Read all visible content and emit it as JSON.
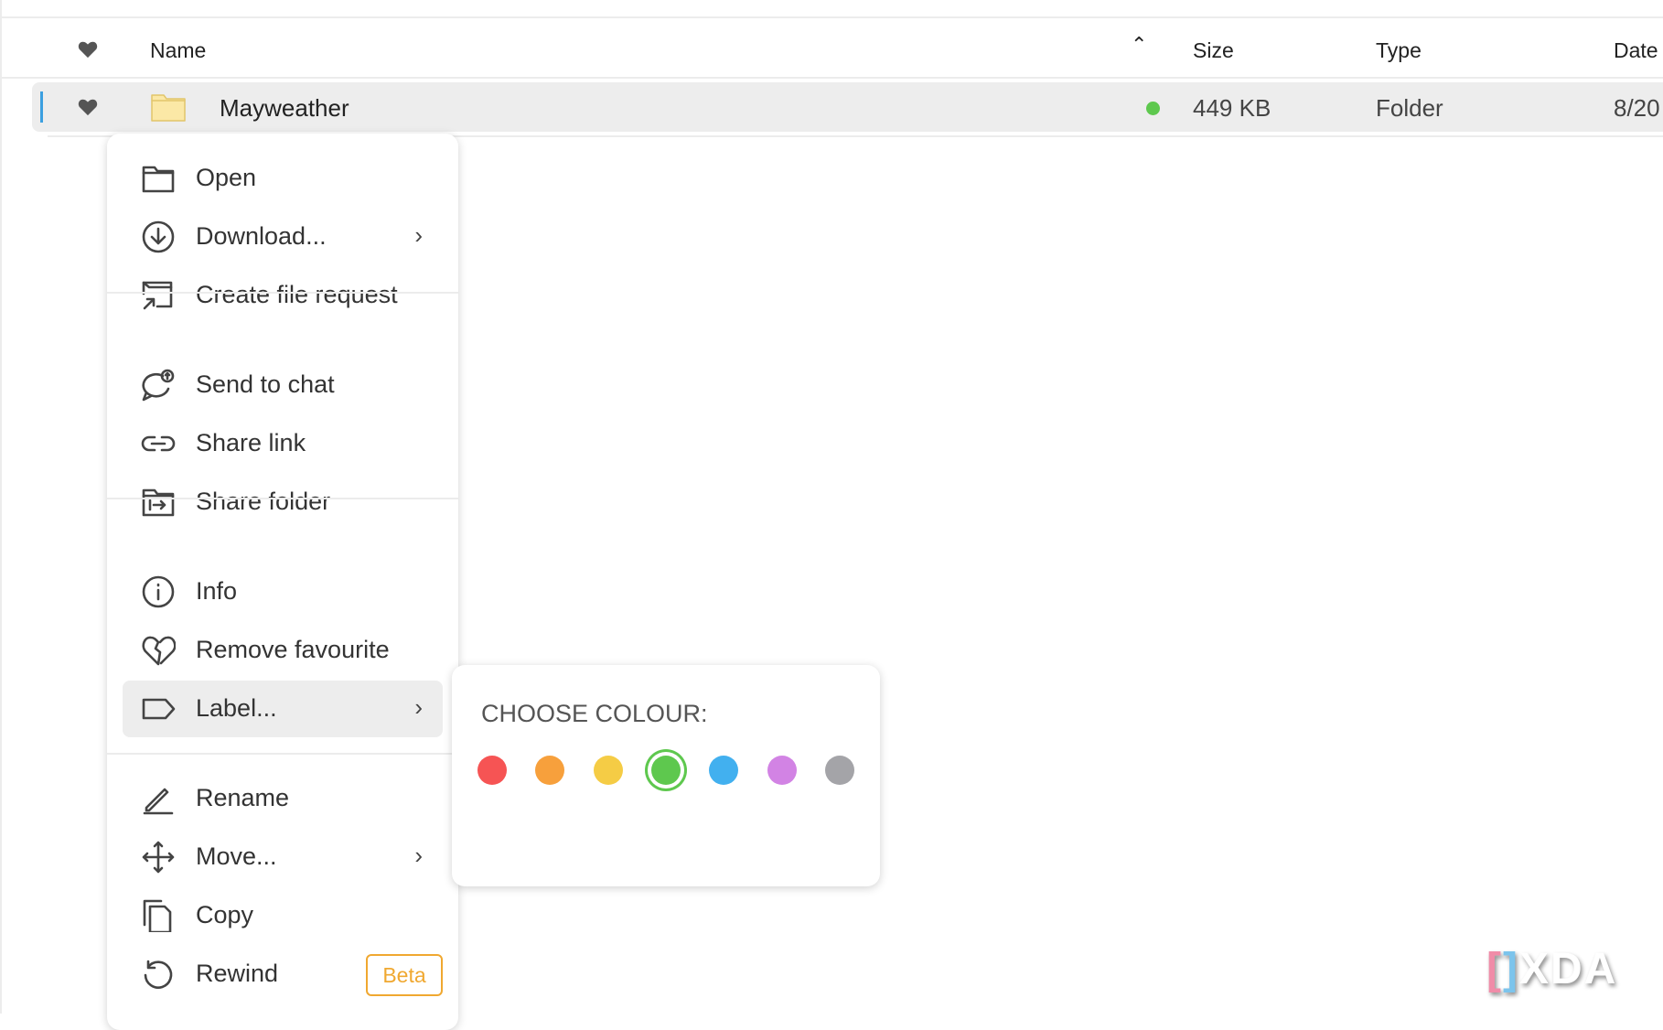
{
  "table": {
    "headers": {
      "name": "Name",
      "size": "Size",
      "type": "Type",
      "date": "Date"
    },
    "rows": [
      {
        "name": "Mayweather",
        "size": "449 KB",
        "type": "Folder",
        "date": "8/20",
        "label_color": "#5ec84e",
        "favourite": true
      }
    ]
  },
  "menu": {
    "items": [
      {
        "label": "Open",
        "icon": "folder-icon"
      },
      {
        "label": "Download...",
        "icon": "download-icon",
        "submenu": true
      },
      {
        "label": "Create file request",
        "icon": "file-request-icon"
      },
      {
        "label": "Send to chat",
        "icon": "chat-icon"
      },
      {
        "label": "Share link",
        "icon": "link-icon"
      },
      {
        "label": "Share folder",
        "icon": "share-folder-icon"
      },
      {
        "label": "Info",
        "icon": "info-icon"
      },
      {
        "label": "Remove favourite",
        "icon": "broken-heart-icon"
      },
      {
        "label": "Label...",
        "icon": "label-icon",
        "submenu": true
      },
      {
        "label": "Rename",
        "icon": "pencil-icon"
      },
      {
        "label": "Move...",
        "icon": "move-icon",
        "submenu": true
      },
      {
        "label": "Copy",
        "icon": "copy-icon"
      },
      {
        "label": "Rewind",
        "icon": "rewind-icon",
        "badge": "Beta"
      }
    ]
  },
  "colour_picker": {
    "title": "CHOOSE COLOUR:",
    "colors": [
      "#f65454",
      "#f7a03c",
      "#f5cc45",
      "#5ec84e",
      "#42b0ef",
      "#d283e4",
      "#a4a4a8"
    ],
    "selected": "#5ec84e"
  },
  "watermark": "XDA"
}
